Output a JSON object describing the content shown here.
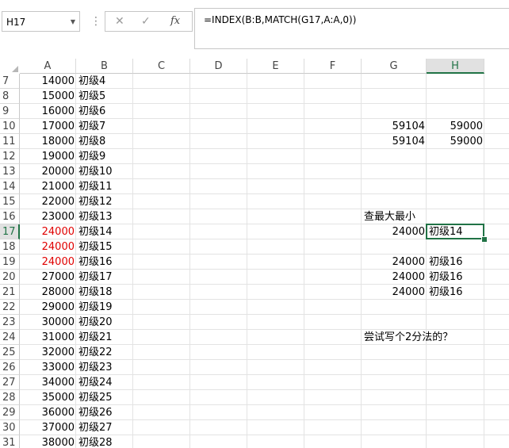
{
  "name_box": {
    "value": "H17"
  },
  "formula_bar": {
    "cancel_icon": "✕",
    "confirm_icon": "✓",
    "fx_label": "fx",
    "formula": "=INDEX(B:B,MATCH(G17,A:A,0))"
  },
  "columns": [
    "A",
    "B",
    "C",
    "D",
    "E",
    "F",
    "G",
    "H"
  ],
  "selected_column": "H",
  "rows": [
    "7",
    "8",
    "9",
    "10",
    "11",
    "12",
    "13",
    "14",
    "15",
    "16",
    "17",
    "18",
    "19",
    "20",
    "21",
    "22",
    "23",
    "24",
    "25",
    "26",
    "27",
    "28",
    "29",
    "30",
    "31"
  ],
  "selected_row": "17",
  "col_a": [
    "14000",
    "15000",
    "16000",
    "17000",
    "18000",
    "19000",
    "20000",
    "21000",
    "22000",
    "23000",
    "24000",
    "24000",
    "24000",
    "27000",
    "28000",
    "29000",
    "30000",
    "31000",
    "32000",
    "33000",
    "34000",
    "35000",
    "36000",
    "37000",
    "38000"
  ],
  "col_b": [
    "初级4",
    "初级5",
    "初级6",
    "初级7",
    "初级8",
    "初级9",
    "初级10",
    "初级11",
    "初级12",
    "初级13",
    "初级14",
    "初级15",
    "初级16",
    "初级17",
    "初级18",
    "初级19",
    "初级20",
    "初级21",
    "初级22",
    "初级23",
    "初级24",
    "初级25",
    "初级26",
    "初级27",
    "初级28"
  ],
  "g10": "59104",
  "h10": "59000",
  "g11": "59104",
  "h11": "59000",
  "g16": "查最大最小",
  "g17": "24000",
  "h17": "初级14",
  "g19": "24000",
  "h19": "初级16",
  "g20": "24000",
  "h20": "初级16",
  "g21": "24000",
  "h21": "初级16",
  "g24": "尝试写个2分法的？",
  "colors": {
    "accent": "#217346",
    "red": "#e00000"
  }
}
